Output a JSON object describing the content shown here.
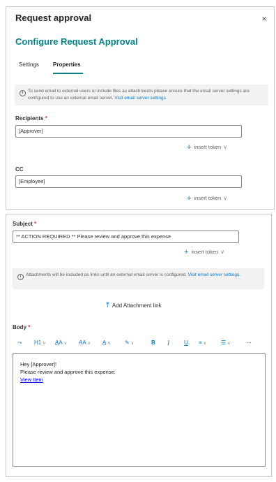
{
  "panel": {
    "title": "Request approval",
    "close_icon": "×",
    "subtitle": "Configure Request Approval",
    "tabs": [
      {
        "label": "Settings",
        "active": false
      },
      {
        "label": "Properties",
        "active": true
      }
    ],
    "info_banner": {
      "text": "To send email to external users or include files as attachments please ensure that the email server settings are configured to use an external email server.",
      "link": "Visit email server settings."
    },
    "recipients": {
      "label": "Recipients",
      "required_mark": "*",
      "value": "[Approver]"
    },
    "cc": {
      "label": "CC",
      "value": "[Employee]"
    },
    "insert_token": {
      "plus": "+",
      "label": "insert token",
      "chevron": "∨"
    }
  },
  "panel2": {
    "subject": {
      "label": "Subject",
      "required_mark": "*",
      "value": "** ACTION REQUIRED ** Please review and approve this expense"
    },
    "insert_token": {
      "plus": "+",
      "label": "insert token",
      "chevron": "∨"
    },
    "attachments_info": {
      "text": "Attachments will be included as links until an external email server is configured.",
      "link": "Visit email server settings."
    },
    "add_attachment": {
      "icon": "⤒",
      "label": "Add Attachment link"
    },
    "body": {
      "label": "Body",
      "required_mark": "*"
    },
    "toolbar": {
      "clear_format": "⤳",
      "heading": "H1",
      "font_size": "A̲A",
      "text_case": "AA",
      "text_color": "A̲",
      "highlight": "✎",
      "bold": "B",
      "italic": "I",
      "underline": "U",
      "align": "≡",
      "list": "☰",
      "more": "···",
      "dropdown": "∨"
    },
    "editor": {
      "lines": [
        "Hey [Approver]!",
        "Please review and approve this expense:"
      ],
      "link_text": "View Item"
    }
  },
  "colors": {
    "accent": "#038387",
    "link": "#0078d4",
    "required": "#d13438"
  }
}
